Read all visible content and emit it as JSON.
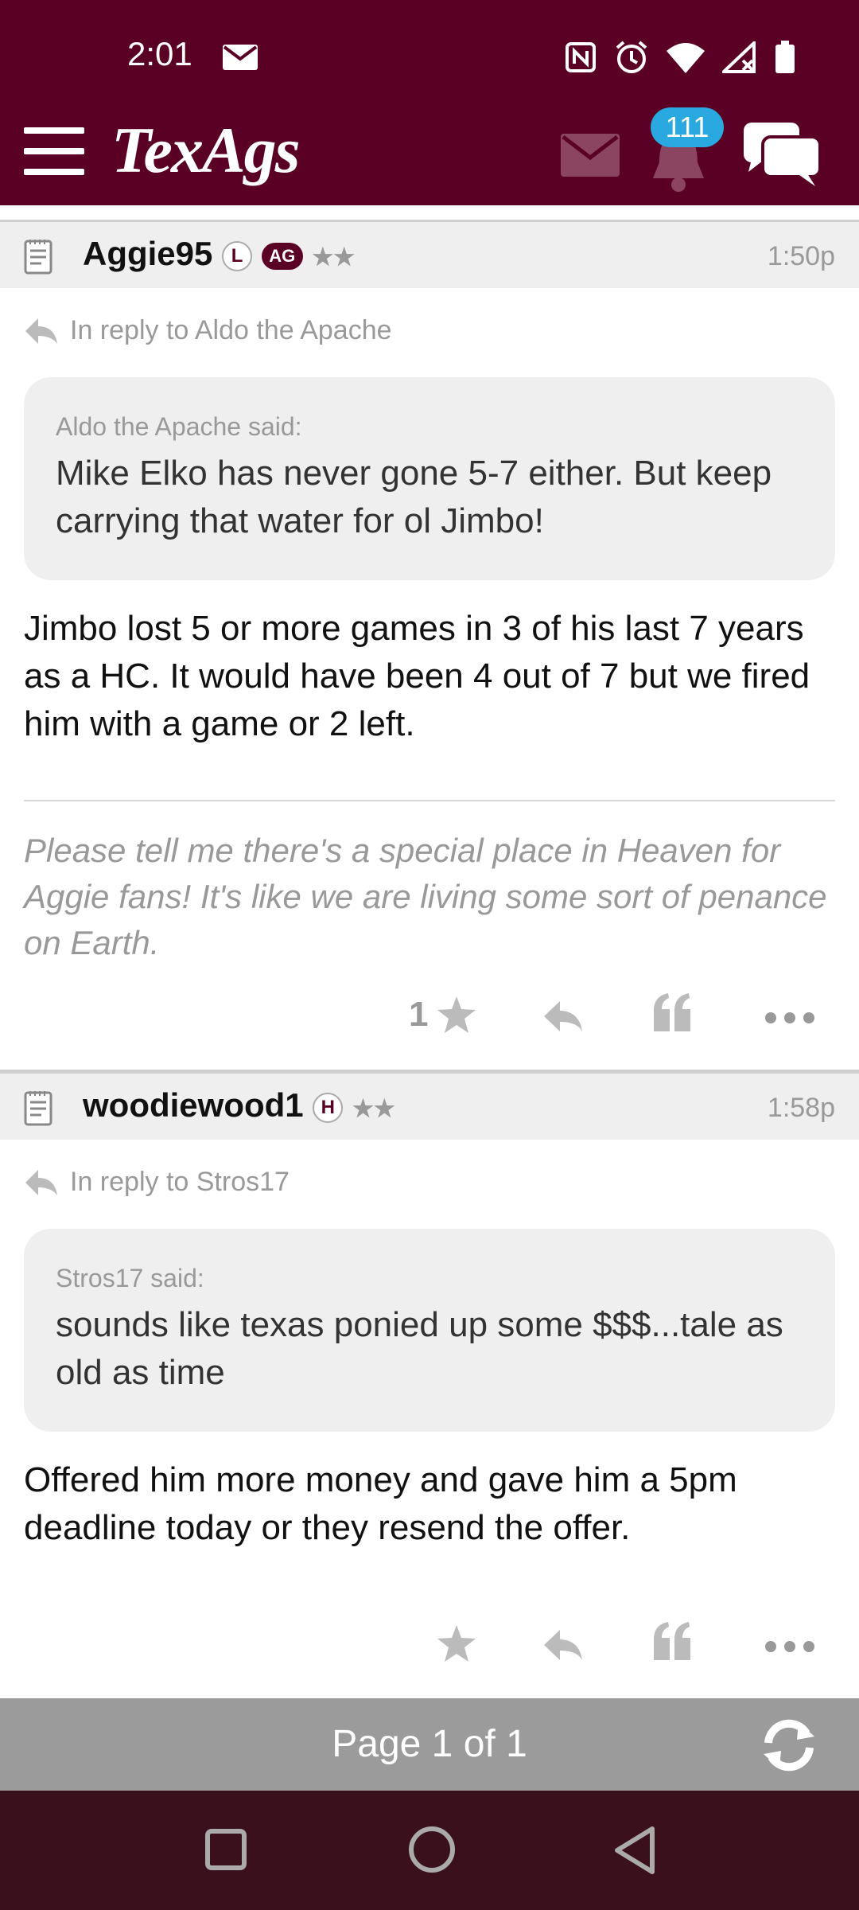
{
  "status_bar": {
    "time": "2:01"
  },
  "header": {
    "logo": "TexAgs",
    "notification_count": "111"
  },
  "posts": [
    {
      "username": "Aggie95",
      "badges": [
        "L",
        "AG"
      ],
      "stars": "★★",
      "time": "1:50p",
      "reply_to": "In reply to Aldo the Apache",
      "quote_author": "Aldo the Apache said:",
      "quote_text": "Mike Elko has never gone 5-7 either. But keep carrying that water for ol Jimbo!",
      "body": "Jimbo lost 5 or more games in 3 of his last 7 years as a HC. It would have been 4 out of 7 but we fired him with a game or 2 left.",
      "signature": "Please tell me there's a special place in Heaven for Aggie fans! It's like we are living some sort of penance on Earth.",
      "rating_count": "1"
    },
    {
      "username": "woodiewood1",
      "badges": [
        "H"
      ],
      "stars": "★★",
      "time": "1:58p",
      "reply_to": "In reply to Stros17",
      "quote_author": "Stros17 said:",
      "quote_text": "sounds like texas ponied up some $$$...tale as old as time",
      "body": "Offered him more money and gave him a 5pm deadline today or they resend the offer."
    }
  ],
  "pager": {
    "label": "Page 1 of 1"
  },
  "colors": {
    "brand": "#5a0024",
    "badge": "#29a9e0",
    "pager": "#9b9b9b"
  }
}
